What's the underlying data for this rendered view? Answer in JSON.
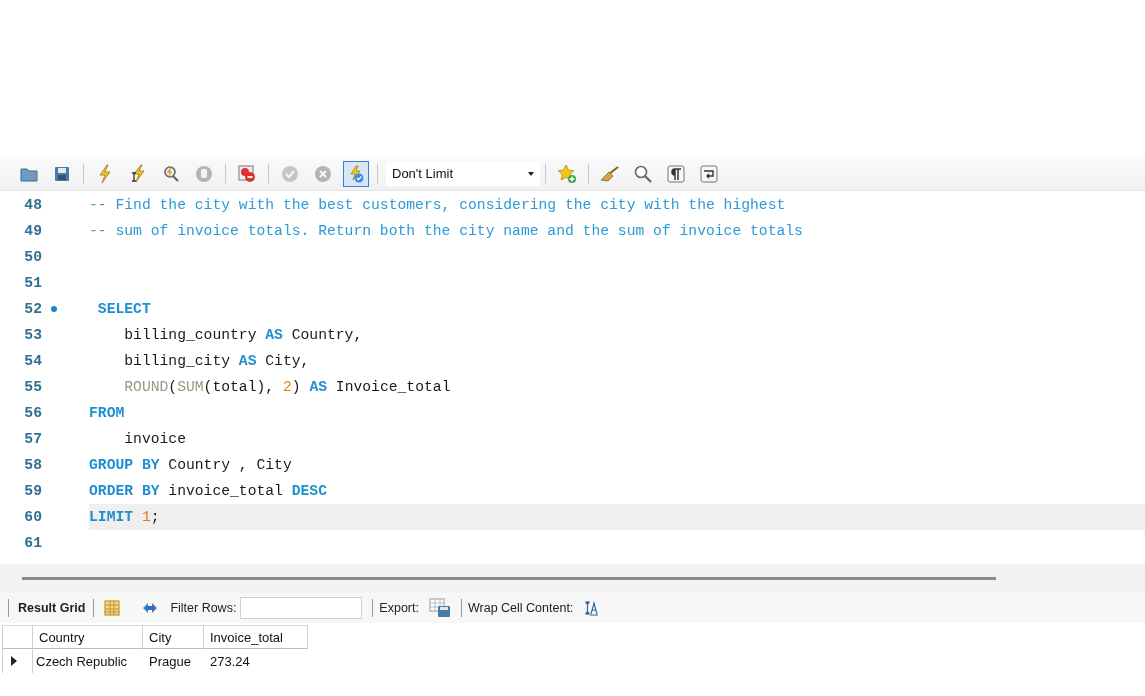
{
  "toolbar": {
    "buttons": [
      {
        "kind": "folder",
        "disabled": false,
        "on": false
      },
      {
        "kind": "save",
        "disabled": false,
        "on": false
      },
      {
        "kind": "sep"
      },
      {
        "kind": "lightning",
        "disabled": false,
        "on": false
      },
      {
        "kind": "lightning-cursor",
        "disabled": false,
        "on": false
      },
      {
        "kind": "explain",
        "disabled": false,
        "on": false
      },
      {
        "kind": "stop",
        "disabled": true,
        "on": false
      },
      {
        "kind": "sep"
      },
      {
        "kind": "error-stop",
        "disabled": false,
        "on": false
      },
      {
        "kind": "sep"
      },
      {
        "kind": "commit",
        "disabled": true,
        "on": false
      },
      {
        "kind": "rollback",
        "disabled": true,
        "on": false
      },
      {
        "kind": "autocommit",
        "disabled": false,
        "on": true
      },
      {
        "kind": "sep"
      },
      {
        "kind": "limit",
        "value": "Don't Limit"
      },
      {
        "kind": "sep"
      },
      {
        "kind": "star-plus",
        "disabled": false,
        "on": false
      },
      {
        "kind": "sep"
      },
      {
        "kind": "broom",
        "disabled": false,
        "on": false
      },
      {
        "kind": "magnifier",
        "disabled": false,
        "on": false
      },
      {
        "kind": "pilcrow",
        "disabled": false,
        "on": false
      },
      {
        "kind": "wrap",
        "disabled": false,
        "on": false
      }
    ]
  },
  "editor": {
    "lines": [
      {
        "number": "48",
        "marker": false,
        "current": false,
        "tokens": [
          {
            "kind": "comment",
            "text": "-- Find the city with the best customers, considering the city with the highest"
          }
        ]
      },
      {
        "number": "49",
        "marker": false,
        "current": false,
        "tokens": [
          {
            "kind": "comment",
            "text": "-- sum of invoice totals. Return both the city name and the sum of invoice totals"
          }
        ]
      },
      {
        "number": "50",
        "marker": false,
        "current": false
      },
      {
        "number": "51",
        "marker": false,
        "current": false
      },
      {
        "number": "52",
        "marker": true,
        "current": false,
        "tokens": [
          {
            "kind": "keyword",
            "text": " SELECT"
          }
        ]
      },
      {
        "number": "53",
        "marker": false,
        "current": false,
        "tokens": [
          {
            "kind": "plain",
            "text": "    billing_country"
          },
          {
            "kind": "keyword",
            "text": " AS"
          },
          {
            "kind": "plain",
            "text": " Country,"
          }
        ]
      },
      {
        "number": "54",
        "marker": false,
        "current": false,
        "tokens": [
          {
            "kind": "plain",
            "text": "    billing_city"
          },
          {
            "kind": "keyword",
            "text": " AS"
          },
          {
            "kind": "plain",
            "text": " City,"
          }
        ]
      },
      {
        "number": "55",
        "marker": false,
        "current": false,
        "tokens": [
          {
            "kind": "function",
            "text": "    ROUND"
          },
          {
            "kind": "plain",
            "text": "("
          },
          {
            "kind": "function",
            "text": "SUM"
          },
          {
            "kind": "plain",
            "text": "(total),"
          },
          {
            "kind": "number",
            "text": " 2"
          },
          {
            "kind": "plain",
            "text": ")"
          },
          {
            "kind": "keyword",
            "text": " AS"
          },
          {
            "kind": "plain",
            "text": " Invoice_total"
          }
        ]
      },
      {
        "number": "56",
        "marker": false,
        "current": false,
        "tokens": [
          {
            "kind": "keyword",
            "text": "FROM"
          }
        ]
      },
      {
        "number": "57",
        "marker": false,
        "current": false,
        "tokens": [
          {
            "kind": "plain",
            "text": "    invoice"
          }
        ]
      },
      {
        "number": "58",
        "marker": false,
        "current": false,
        "tokens": [
          {
            "kind": "keyword",
            "text": "GROUP BY"
          },
          {
            "kind": "plain",
            "text": " Country , City"
          }
        ]
      },
      {
        "number": "59",
        "marker": false,
        "current": false,
        "tokens": [
          {
            "kind": "keyword",
            "text": "ORDER BY"
          },
          {
            "kind": "plain",
            "text": " invoice_total"
          },
          {
            "kind": "keyword",
            "text": " DESC"
          }
        ]
      },
      {
        "number": "60",
        "marker": false,
        "current": true,
        "tokens": [
          {
            "kind": "keyword",
            "text": "LIMIT"
          },
          {
            "kind": "number",
            "text": " 1"
          },
          {
            "kind": "plain",
            "text": ";"
          }
        ]
      },
      {
        "number": "61",
        "marker": false,
        "current": false
      }
    ]
  },
  "results": {
    "tab": "Result Grid",
    "filter_label": "Filter Rows:",
    "export_label": "Export:",
    "wrap_label": "Wrap Cell Content:",
    "table": {
      "columns": [
        "Country",
        "City",
        "Invoice_total"
      ],
      "rows": [
        {
          "current": true,
          "cells": [
            "Czech Republic",
            "Prague",
            "273.24"
          ]
        }
      ]
    }
  }
}
